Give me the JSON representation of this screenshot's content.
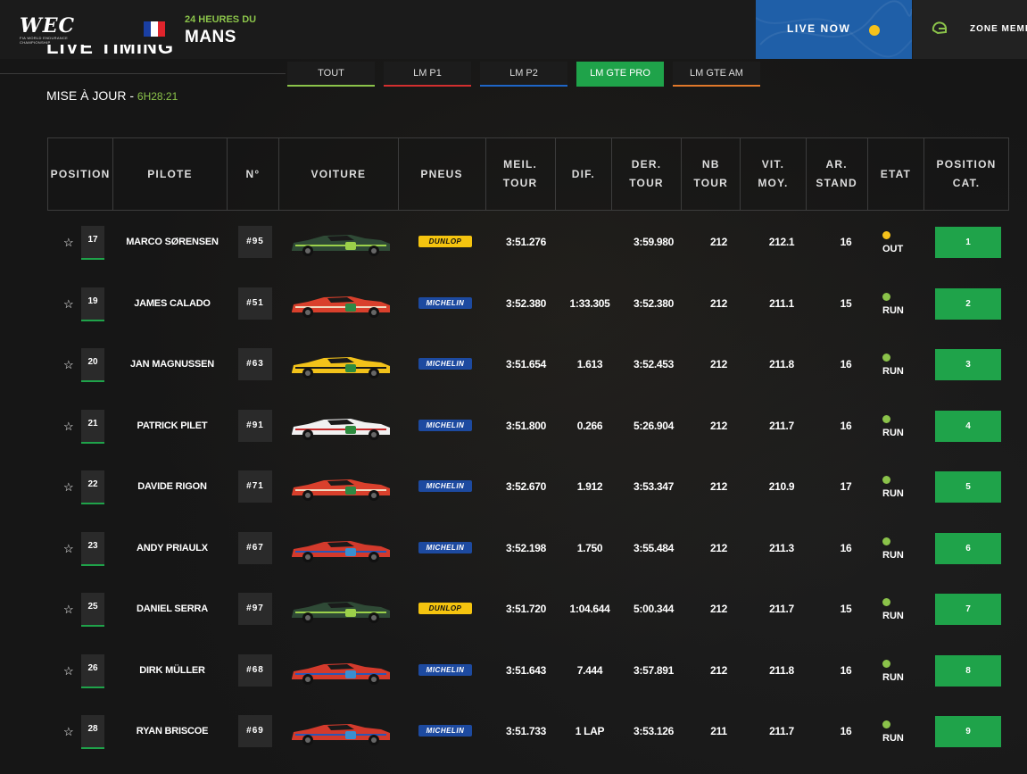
{
  "header": {
    "logo_text": "WEC",
    "logo_subtitle": "FIA WORLD ENDURANCE CHAMPIONSHIP",
    "event_line1": "24 HEURES DU",
    "event_line2": "MANS",
    "live_label": "LIVE NOW",
    "zone_label": "ZONE MEMBRE",
    "live_color": "#1f5fa8",
    "flag_colors": [
      "#1a3fa3",
      "#ffffff",
      "#e0242c"
    ]
  },
  "page_title": "LIVE TIMING",
  "update": {
    "label": "MISE À JOUR - ",
    "time": "6H28:21"
  },
  "tabs": [
    {
      "label": "TOUT",
      "color": "#8bc34a",
      "active": false
    },
    {
      "label": "LM P1",
      "color": "#d32f2f",
      "active": false
    },
    {
      "label": "LM P2",
      "color": "#1e66c8",
      "active": false
    },
    {
      "label": "LM GTE PRO",
      "color": "#1fa34a",
      "active": true
    },
    {
      "label": "LM GTE AM",
      "color": "#e0782a",
      "active": false
    }
  ],
  "columns": [
    "POSITION",
    "PILOTE",
    "N°",
    "VOITURE",
    "PNEUS",
    "MEIL.\nTOUR",
    "DIF.",
    "DER.\nTOUR",
    "NB\nTOUR",
    "VIT.\nMOY.",
    "AR.\nSTAND",
    "ETAT",
    "POSITION\nCAT."
  ],
  "rows": [
    {
      "pos": "17",
      "pilot": "MARCO SØRENSEN",
      "num": "#95",
      "car": "aston-martin",
      "tyre": "DUNLOP",
      "best": "3:51.276",
      "diff": "",
      "last": "3:59.980",
      "laps": "212",
      "speed": "212.1",
      "pit": "16",
      "state": "OUT",
      "state_color": "#f6c21b",
      "cat": "1"
    },
    {
      "pos": "19",
      "pilot": "JAMES CALADO",
      "num": "#51",
      "car": "ferrari",
      "tyre": "MICHELIN",
      "best": "3:52.380",
      "diff": "1:33.305",
      "last": "3:52.380",
      "laps": "212",
      "speed": "211.1",
      "pit": "15",
      "state": "RUN",
      "state_color": "#8bc34a",
      "cat": "2"
    },
    {
      "pos": "20",
      "pilot": "JAN MAGNUSSEN",
      "num": "#63",
      "car": "corvette",
      "tyre": "MICHELIN",
      "best": "3:51.654",
      "diff": "1.613",
      "last": "3:52.453",
      "laps": "212",
      "speed": "211.8",
      "pit": "16",
      "state": "RUN",
      "state_color": "#8bc34a",
      "cat": "3"
    },
    {
      "pos": "21",
      "pilot": "PATRICK PILET",
      "num": "#91",
      "car": "porsche",
      "tyre": "MICHELIN",
      "best": "3:51.800",
      "diff": "0.266",
      "last": "5:26.904",
      "laps": "212",
      "speed": "211.7",
      "pit": "16",
      "state": "RUN",
      "state_color": "#8bc34a",
      "cat": "4"
    },
    {
      "pos": "22",
      "pilot": "DAVIDE RIGON",
      "num": "#71",
      "car": "ferrari",
      "tyre": "MICHELIN",
      "best": "3:52.670",
      "diff": "1.912",
      "last": "3:53.347",
      "laps": "212",
      "speed": "210.9",
      "pit": "17",
      "state": "RUN",
      "state_color": "#8bc34a",
      "cat": "5"
    },
    {
      "pos": "23",
      "pilot": "ANDY PRIAULX",
      "num": "#67",
      "car": "ford",
      "tyre": "MICHELIN",
      "best": "3:52.198",
      "diff": "1.750",
      "last": "3:55.484",
      "laps": "212",
      "speed": "211.3",
      "pit": "16",
      "state": "RUN",
      "state_color": "#8bc34a",
      "cat": "6"
    },
    {
      "pos": "25",
      "pilot": "DANIEL SERRA",
      "num": "#97",
      "car": "aston-martin",
      "tyre": "DUNLOP",
      "best": "3:51.720",
      "diff": "1:04.644",
      "last": "5:00.344",
      "laps": "212",
      "speed": "211.7",
      "pit": "15",
      "state": "RUN",
      "state_color": "#8bc34a",
      "cat": "7"
    },
    {
      "pos": "26",
      "pilot": "DIRK MÜLLER",
      "num": "#68",
      "car": "ford",
      "tyre": "MICHELIN",
      "best": "3:51.643",
      "diff": "7.444",
      "last": "3:57.891",
      "laps": "212",
      "speed": "211.8",
      "pit": "16",
      "state": "RUN",
      "state_color": "#8bc34a",
      "cat": "8"
    },
    {
      "pos": "28",
      "pilot": "RYAN BRISCOE",
      "num": "#69",
      "car": "ford",
      "tyre": "MICHELIN",
      "best": "3:51.733",
      "diff": "1 LAP",
      "last": "3:53.126",
      "laps": "211",
      "speed": "211.7",
      "pit": "16",
      "state": "RUN",
      "state_color": "#8bc34a",
      "cat": "9"
    }
  ],
  "car_colors": {
    "aston-martin": {
      "body": "#2f4a36",
      "accent": "#9bd04a",
      "number_bg": "#9bd04a"
    },
    "ferrari": {
      "body": "#d9402c",
      "accent": "#f0d9c0",
      "number_bg": "#2d8a45"
    },
    "corvette": {
      "body": "#f2c21a",
      "accent": "#1a1a1a",
      "number_bg": "#2e8b3e"
    },
    "porsche": {
      "body": "#f1f1f1",
      "accent": "#c62828",
      "number_bg": "#2e8b3e"
    },
    "ford": {
      "body": "#d33a2c",
      "accent": "#2a57b5",
      "number_bg": "#3a8fd0"
    }
  },
  "star_icon": "☆"
}
